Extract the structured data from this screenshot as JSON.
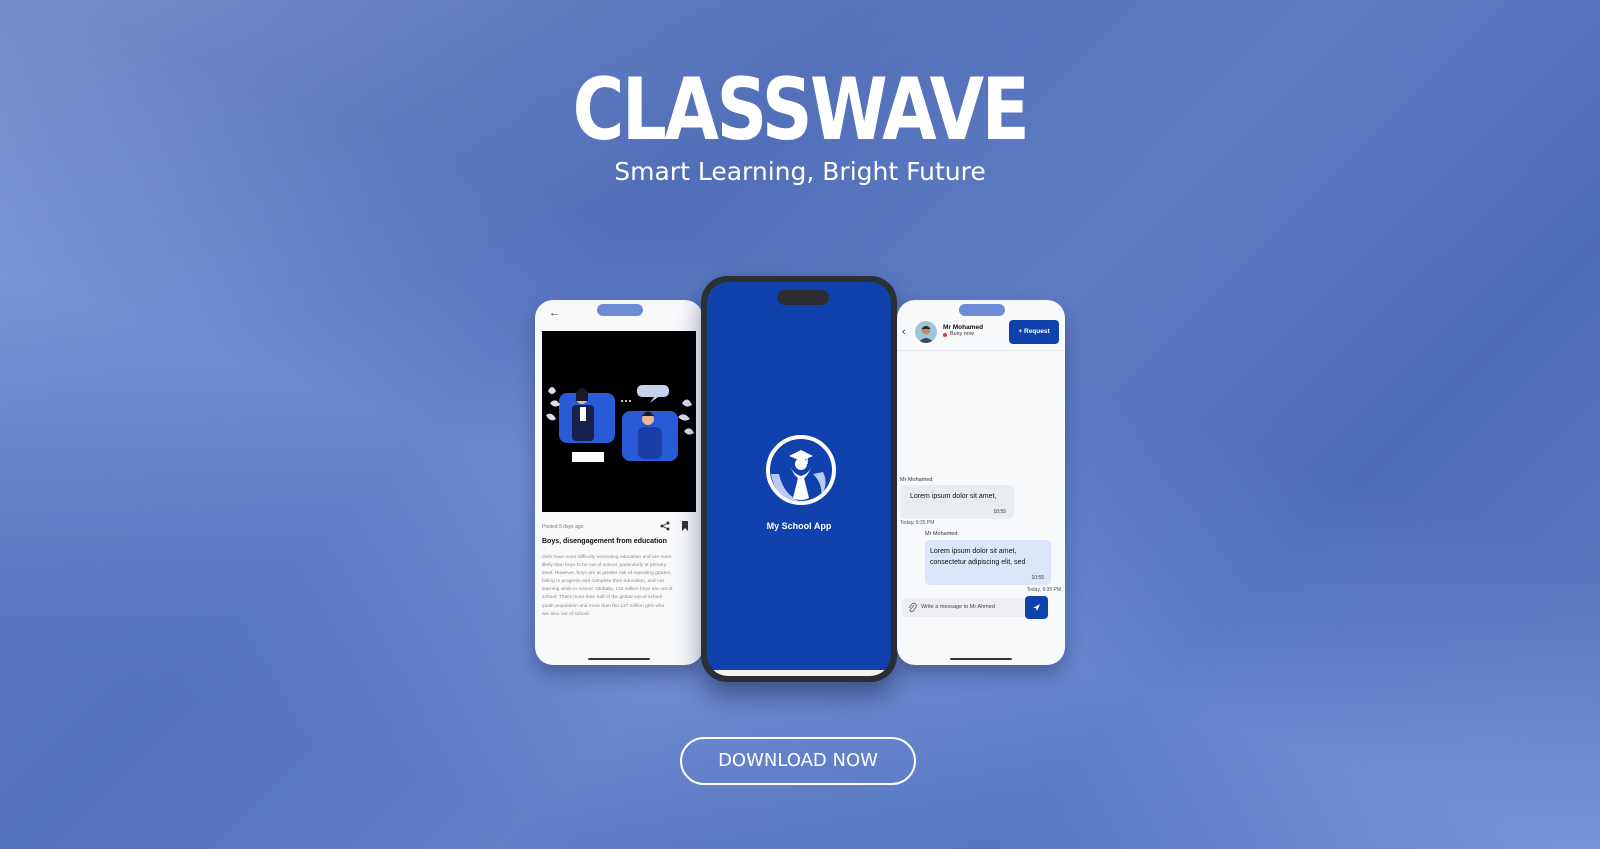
{
  "brand": {
    "title": "CLASSWAVE",
    "tagline": "Smart Learning, Bright Future",
    "cta_label": "DOWNLOAD NOW",
    "colors": {
      "primary": "#1042ad",
      "background": "#6485d1",
      "accent_light": "#dbe6fb"
    }
  },
  "left_screen": {
    "posted": "Posted 5 days ago",
    "headline": "Boys, disengagement from education",
    "body_lines": [
      "Girls have more difficulty accessing education and are more",
      "likely than boys to be out of school, particularly at primary",
      "level. However, boys are at greater risk of repeating grades,",
      "failing to progress and complete their education, and not",
      "learning while in school. Globally, 132 million boys are out of",
      "school. That's more than half of the global out-of-school",
      "youth population and more than the 127 million girls who",
      "are also out of school."
    ],
    "icons": [
      "back-arrow-icon",
      "share-icon",
      "bookmark-icon"
    ]
  },
  "center_screen": {
    "app_name": "My School App",
    "icons": [
      "graduate-logo-icon"
    ]
  },
  "right_screen": {
    "contact_name": "Mr Mohamed",
    "status": "Busy now",
    "request_label": "+ Request",
    "messages": [
      {
        "sender": "Mr Mohamed",
        "text": "Lorem ipsum dolor sit amet,",
        "time": "10:55",
        "date": "Today, 9:35 PM"
      },
      {
        "sender": "Mr Mohamed",
        "text": "Lorem ipsum dolor sit amet, consectetur adipiscing elit, sed",
        "time": "10:55",
        "date": "Today, 9:35 PM"
      }
    ],
    "input_placeholder": "Write a message to Mr Ahmed",
    "icons": [
      "back-chevron-icon",
      "avatar",
      "paperclip-icon",
      "send-icon"
    ]
  }
}
